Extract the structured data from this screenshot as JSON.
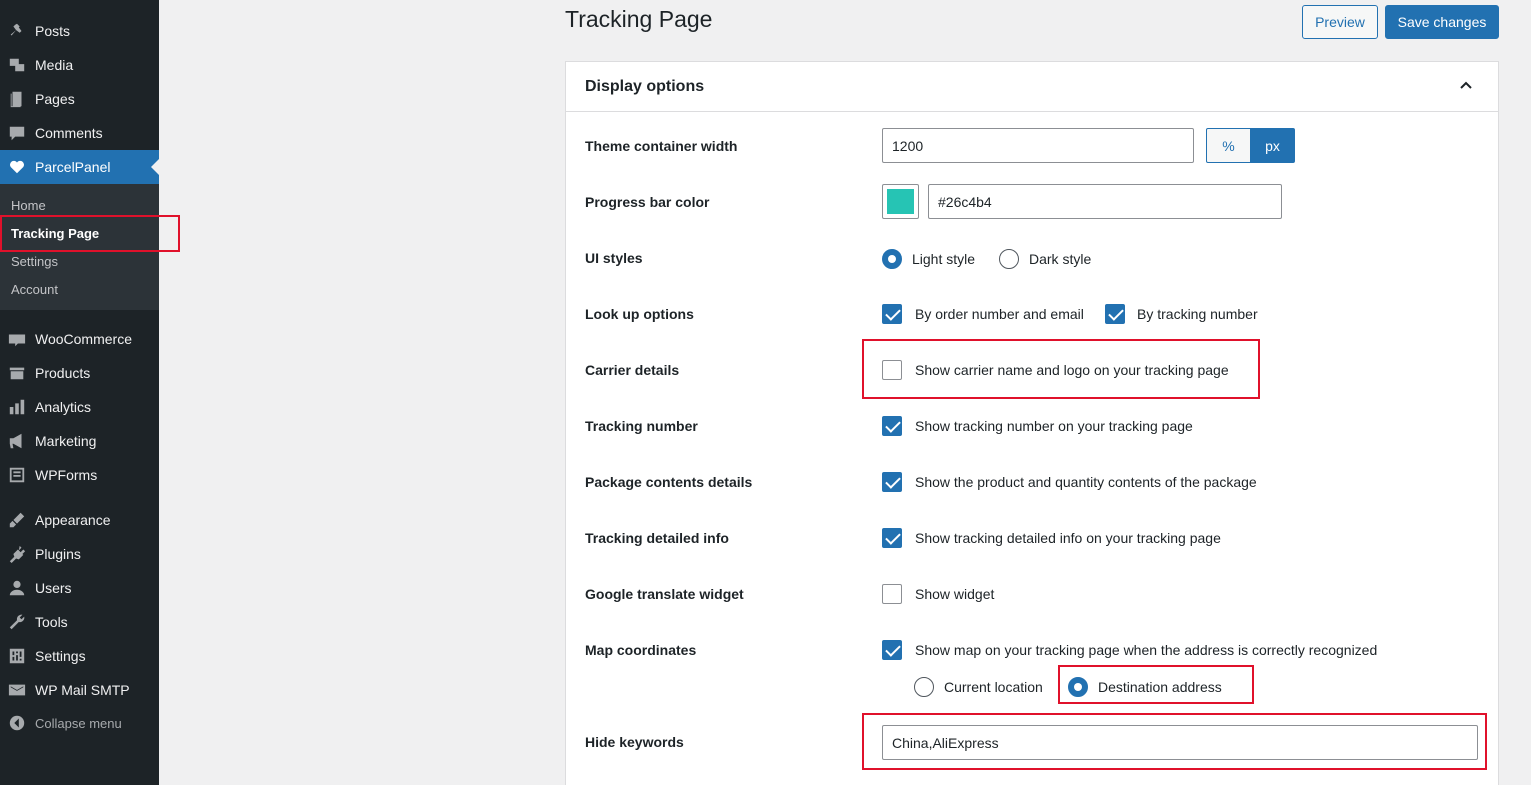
{
  "sidebar": {
    "items_top": [
      {
        "label": "Posts",
        "icon": "pin-icon"
      },
      {
        "label": "Media",
        "icon": "media-icon"
      },
      {
        "label": "Pages",
        "icon": "pages-icon"
      },
      {
        "label": "Comments",
        "icon": "comments-icon"
      },
      {
        "label": "ParcelPanel",
        "icon": "heart-icon"
      }
    ],
    "submenu": [
      "Home",
      "Tracking Page",
      "Settings",
      "Account"
    ],
    "items_bottom": [
      {
        "label": "WooCommerce",
        "icon": "woo-icon"
      },
      {
        "label": "Products",
        "icon": "products-icon"
      },
      {
        "label": "Analytics",
        "icon": "analytics-icon"
      },
      {
        "label": "Marketing",
        "icon": "megaphone-icon"
      },
      {
        "label": "WPForms",
        "icon": "forms-icon"
      },
      {
        "label": "Appearance",
        "icon": "brush-icon"
      },
      {
        "label": "Plugins",
        "icon": "plug-icon"
      },
      {
        "label": "Users",
        "icon": "user-icon"
      },
      {
        "label": "Tools",
        "icon": "wrench-icon"
      },
      {
        "label": "Settings",
        "icon": "settings-icon"
      },
      {
        "label": "WP Mail SMTP",
        "icon": "mail-icon"
      },
      {
        "label": "Collapse menu",
        "icon": "collapse-icon"
      }
    ]
  },
  "header": {
    "title": "Tracking Page",
    "preview_label": "Preview",
    "save_label": "Save changes"
  },
  "panel": {
    "title": "Display options",
    "rows": {
      "container_width": {
        "label": "Theme container width",
        "value": "1200",
        "units": [
          "%",
          "px"
        ],
        "selected_unit": "px"
      },
      "progress_color": {
        "label": "Progress bar color",
        "value": "#26c4b4"
      },
      "ui_styles": {
        "label": "UI styles",
        "options": [
          "Light style",
          "Dark style"
        ],
        "selected": "Light style"
      },
      "lookup": {
        "label": "Look up options",
        "options": [
          "By order number and email",
          "By tracking number"
        ]
      },
      "carrier": {
        "label": "Carrier details",
        "option": "Show carrier name and logo on your tracking page"
      },
      "tracking_number": {
        "label": "Tracking number",
        "option": "Show tracking number on your tracking page"
      },
      "package_contents": {
        "label": "Package contents details",
        "option": "Show the product and quantity contents of the package"
      },
      "tracking_info": {
        "label": "Tracking detailed info",
        "option": "Show tracking detailed info on your tracking page"
      },
      "translate": {
        "label": "Google translate widget",
        "option": "Show widget"
      },
      "map": {
        "label": "Map coordinates",
        "option": "Show map on your tracking page when the address is correctly recognized",
        "sub_options": [
          "Current location",
          "Destination address"
        ],
        "selected": "Destination address"
      },
      "hide_keywords": {
        "label": "Hide keywords",
        "value": "China,AliExpress"
      }
    }
  },
  "colors": {
    "accent": "#2271b1",
    "highlight": "#e0112b",
    "progress": "#26c4b4"
  }
}
